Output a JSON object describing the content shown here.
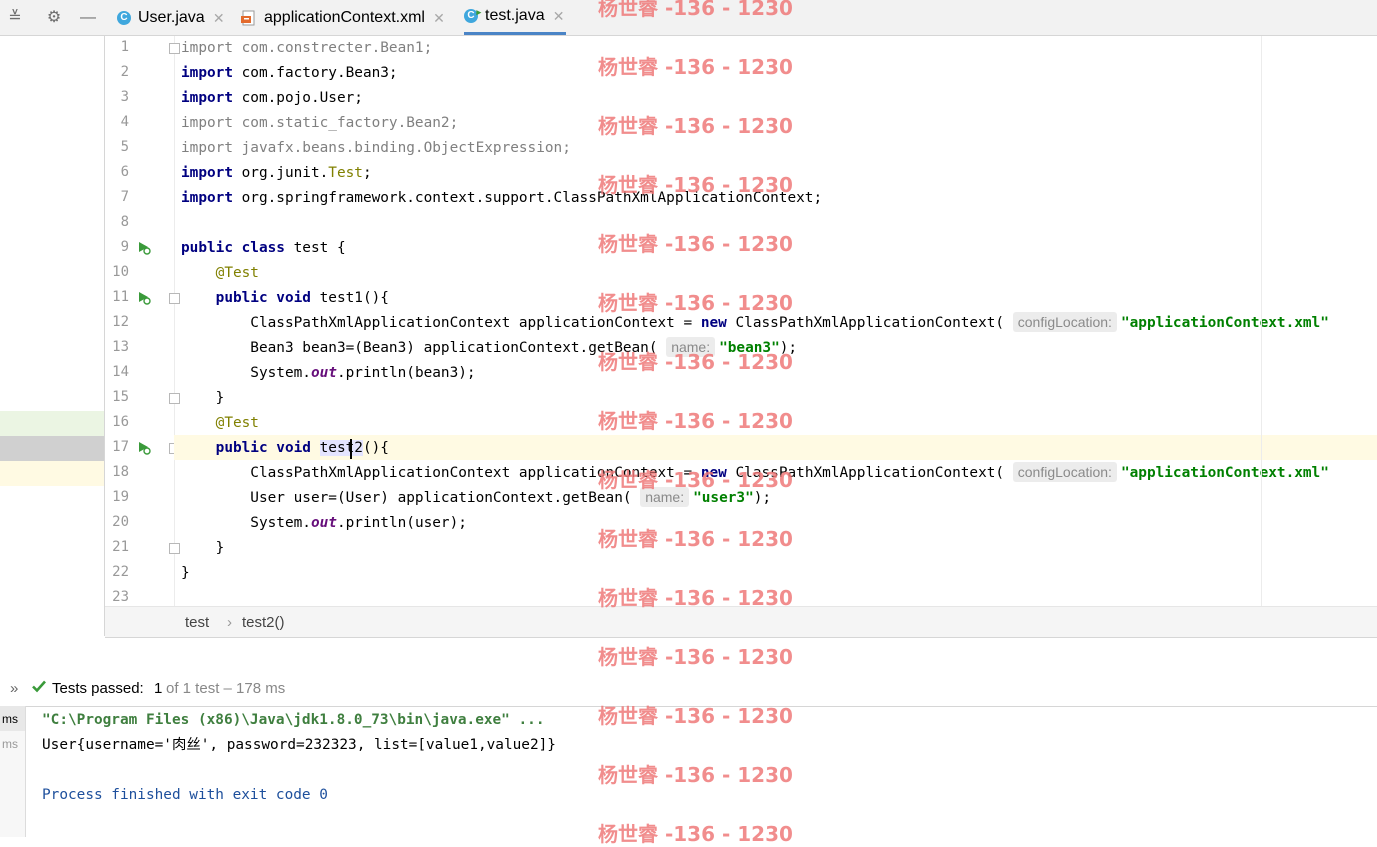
{
  "tabs": [
    {
      "label": "User.java",
      "icon": "java-class-icon",
      "active": false
    },
    {
      "label": "applicationContext.xml",
      "icon": "xml-file-icon",
      "active": false
    },
    {
      "label": "test.java",
      "icon": "java-test-class-icon",
      "active": true
    }
  ],
  "code_lines": [
    {
      "n": "1",
      "html": "<span class='gray'>import com.constrecter.Bean1;</span>"
    },
    {
      "n": "2",
      "html": "<span class='kw'>import</span> com.factory.Bean3;"
    },
    {
      "n": "3",
      "html": "<span class='kw'>import</span> com.pojo.User;"
    },
    {
      "n": "4",
      "html": "<span class='gray'>import com.static_factory.Bean2;</span>"
    },
    {
      "n": "5",
      "html": "<span class='gray'>import javafx.beans.binding.ObjectExpression;</span>"
    },
    {
      "n": "6",
      "html": "<span class='kw'>import</span> org.junit.<span class='ann'>Test</span>;"
    },
    {
      "n": "7",
      "html": "<span class='kw'>import</span> org.springframework.context.support.ClassPathXmlApplicationContext;"
    },
    {
      "n": "8",
      "html": ""
    },
    {
      "n": "9",
      "html": "<span class='kw'>public class</span> test {"
    },
    {
      "n": "10",
      "html": "    <span class='ann'>@Test</span>"
    },
    {
      "n": "11",
      "html": "    <span class='kw'>public void</span> test1(){"
    },
    {
      "n": "12",
      "html": "        ClassPathXmlApplicationContext applicationContext = <span class='kw'>new</span> ClassPathXmlApplicationContext( <span class='hint'>configLocation:</span><span class='str'>\"applicationContext.xml\"</span>"
    },
    {
      "n": "13",
      "html": "        Bean3 bean3=(Bean3) applicationContext.getBean( <span class='hint'>name:</span><span class='str'>\"bean3\"</span>);"
    },
    {
      "n": "14",
      "html": "        System.<span class='field'>out</span>.println(bean3);"
    },
    {
      "n": "15",
      "html": "    }"
    },
    {
      "n": "16",
      "html": "    <span class='ann'>@Test</span>"
    },
    {
      "n": "17",
      "html": "    <span class='kw'>public void</span> <span class='hl'>test2</span>(){"
    },
    {
      "n": "18",
      "html": "        ClassPathXmlApplicationContext applicationContext = <span class='kw'>new</span> ClassPathXmlApplicationContext( <span class='hint'>configLocation:</span><span class='str'>\"applicationContext.xml\"</span>"
    },
    {
      "n": "19",
      "html": "        User user=(User) applicationContext.getBean( <span class='hint'>name:</span><span class='str'>\"user3\"</span>);"
    },
    {
      "n": "20",
      "html": "        System.<span class='field'>out</span>.println(user);"
    },
    {
      "n": "21",
      "html": "    }"
    },
    {
      "n": "22",
      "html": "}"
    },
    {
      "n": "23",
      "html": ""
    }
  ],
  "run_markers": [
    "9",
    "11",
    "17"
  ],
  "fold_markers": [
    "1",
    "11",
    "15",
    "17",
    "21"
  ],
  "breadcrumb": {
    "class_name": "test",
    "separator": "›",
    "method": "test2()"
  },
  "run_panel": {
    "expand_glyph": "»",
    "status_label": "Tests passed:",
    "passed": "1",
    "summary": "of 1 test – 178 ms"
  },
  "console": {
    "side_labels": [
      "ms",
      "ms"
    ],
    "cmd": "\"C:\\Program Files (x86)\\Java\\jdk1.8.0_73\\bin\\java.exe\" ...",
    "output": "User{username='肉丝', password=232323, list=[value1,value2]}",
    "exit": "Process finished with exit code 0"
  },
  "watermark": "杨世睿 -136 - 1230",
  "colors": {
    "keyword": "#000080",
    "string": "#008000",
    "annotation": "#808000",
    "watermark": "#ef7a7a",
    "accent": "#4a84c6",
    "pass_green": "#3a9a3a"
  }
}
